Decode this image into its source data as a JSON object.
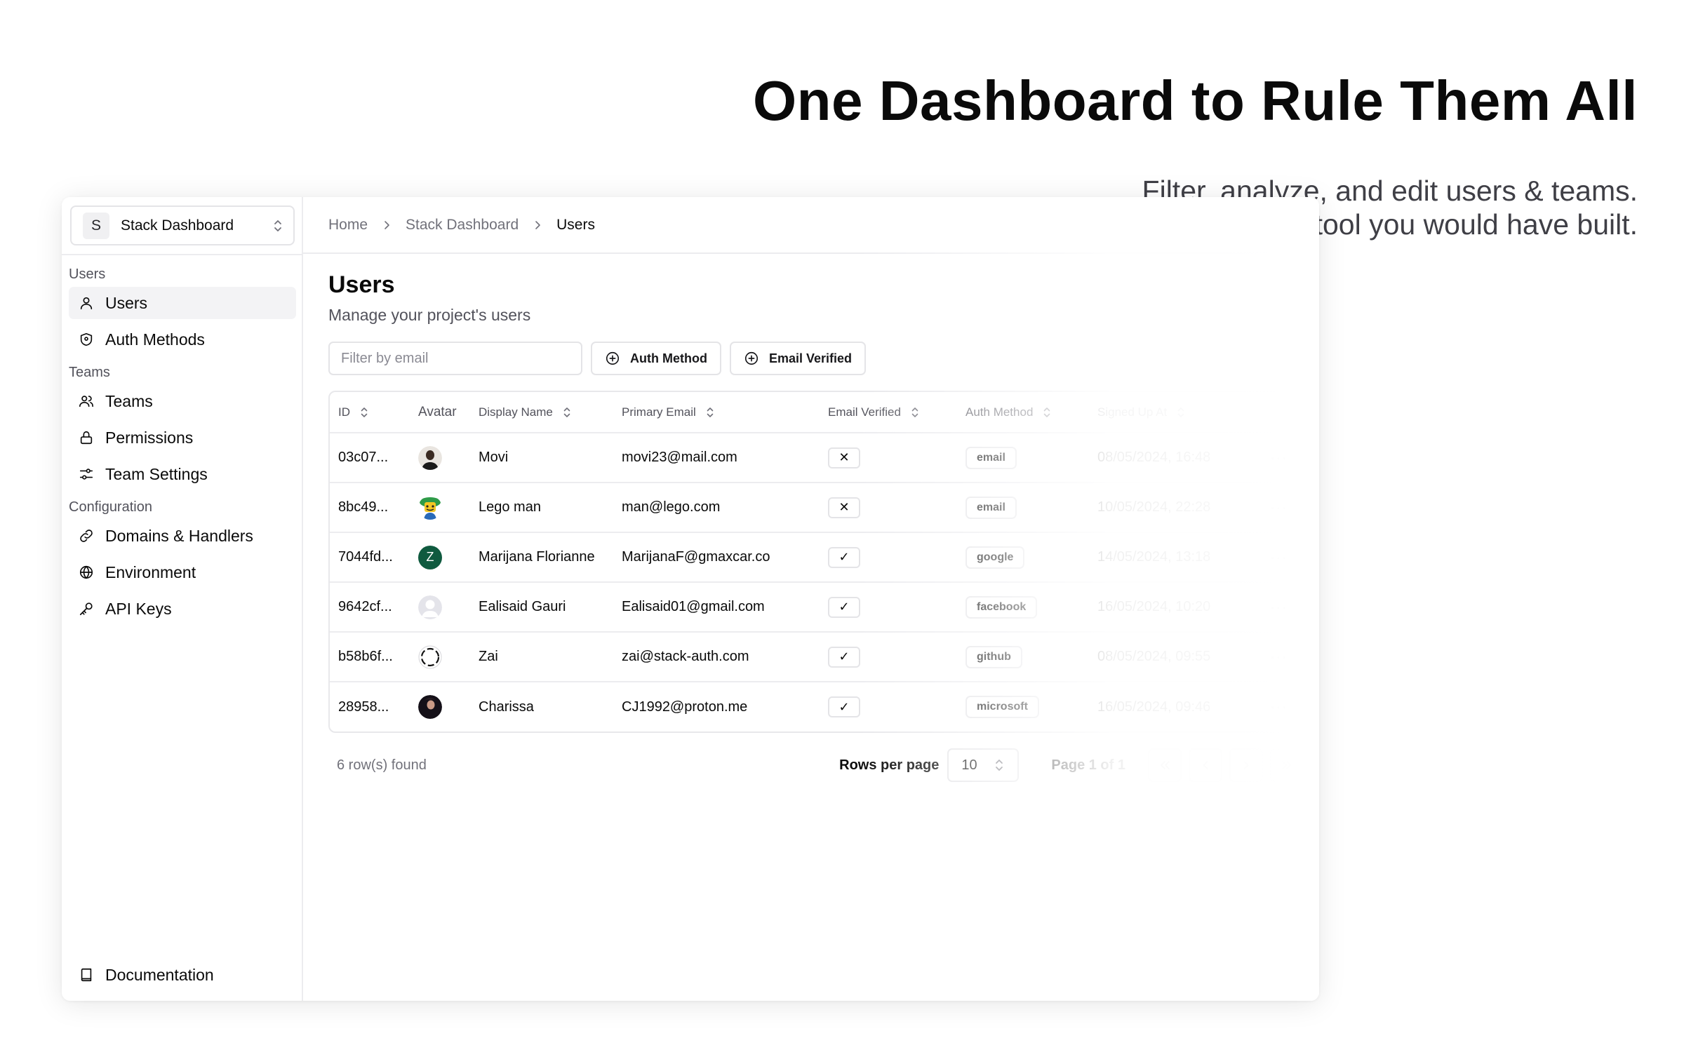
{
  "hero": {
    "title": "One Dashboard to Rule Them All",
    "subtitle_line1": "Filter, analyze, and edit users & teams.",
    "subtitle_line2": "Replaces the first internal tool you would have built."
  },
  "project": {
    "badge": "S",
    "name": "Stack Dashboard"
  },
  "sidebar": {
    "groups": {
      "users": "Users",
      "teams": "Teams",
      "configuration": "Configuration"
    },
    "items": {
      "users": "Users",
      "auth_methods": "Auth Methods",
      "teams": "Teams",
      "permissions": "Permissions",
      "team_settings": "Team Settings",
      "domains": "Domains & Handlers",
      "environment": "Environment",
      "api_keys": "API Keys",
      "documentation": "Documentation"
    },
    "active": "users"
  },
  "breadcrumb": [
    "Home",
    "Stack Dashboard",
    "Users"
  ],
  "page": {
    "title": "Users",
    "subtitle": "Manage your project's users"
  },
  "filters": {
    "email_placeholder": "Filter by email",
    "auth_method": "Auth Method",
    "email_verified": "Email Verified"
  },
  "table": {
    "columns": {
      "id": "ID",
      "avatar": "Avatar",
      "display_name": "Display Name",
      "primary_email": "Primary Email",
      "email_verified": "Email Verified",
      "auth_method": "Auth Method",
      "signed_up_at": "Signed Up At"
    },
    "rows": [
      {
        "id": "03c07...",
        "name": "Movi",
        "email": "movi23@mail.com",
        "verified": "✕",
        "auth": "email",
        "signed_up": "08/05/2024, 16:48"
      },
      {
        "id": "8bc49...",
        "name": "Lego man",
        "email": "man@lego.com",
        "verified": "✕",
        "auth": "email",
        "signed_up": "10/05/2024, 22:28"
      },
      {
        "id": "7044fd...",
        "name": "Marijana Florianne",
        "email": "MarijanaF@gmaxcar.co",
        "verified": "✓",
        "auth": "google",
        "signed_up": "14/05/2024, 13:18",
        "avatar_initial": "Z"
      },
      {
        "id": "9642cf...",
        "name": "Ealisaid Gauri",
        "email": "Ealisaid01@gmail.com",
        "verified": "✓",
        "auth": "facebook",
        "signed_up": "16/05/2024, 10:20"
      },
      {
        "id": "b58b6f...",
        "name": "Zai",
        "email": "zai@stack-auth.com",
        "verified": "✓",
        "auth": "github",
        "signed_up": "08/05/2024, 09:55"
      },
      {
        "id": "28958...",
        "name": "Charissa",
        "email": "CJ1992@proton.me",
        "verified": "✓",
        "auth": "microsoft",
        "signed_up": "16/05/2024, 09:46"
      }
    ],
    "row_actions": "···"
  },
  "pagination": {
    "row_count": "6 row(s) found",
    "rows_per_page_label": "Rows per page",
    "rows_per_page_value": "10",
    "page_info": "Page 1 of 1"
  },
  "colors": {
    "border": "#e4e4e7",
    "muted_text": "#71717a",
    "active_bg": "#f3f3f5",
    "avatar_green": "#0f5a3f"
  }
}
